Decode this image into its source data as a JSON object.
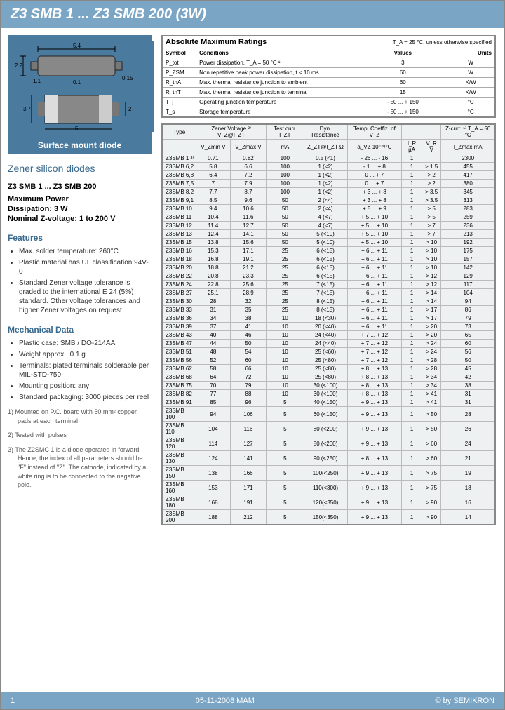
{
  "header": "Z3 SMB 1 ... Z3 SMB 200 (3W)",
  "diagram_caption": "Surface mount diode",
  "subtitle": "Zener silicon diodes",
  "part_range": "Z3 SMB 1 ... Z3 SMB 200",
  "spec1": "Maximum Power",
  "spec2": "Dissipation: 3 W",
  "spec3": "Nominal Z-voltage: 1 to 200 V",
  "features_hdr": "Features",
  "features": [
    "Max. solder temperature: 260°C",
    "Plastic material has UL classification 94V-0",
    "Standard Zener voltage tolerance is graded to the international E 24 (5%) standard. Other voltage tolerances and higher Zener voltages on request."
  ],
  "mech_hdr": "Mechanical Data",
  "mech": [
    "Plastic case: SMB / DO-214AA",
    "Weight approx.: 0.1 g",
    "Terminals: plated terminals solderable per MIL-STD-750",
    "Mounting position: any",
    "Standard packaging: 3000 pieces per reel"
  ],
  "notes": [
    "1) Mounted on P.C. board with 50 mm² copper pads at each terminal",
    "2) Tested with pulses",
    "3) The Z2SMC 1 is a diode operated in forward. Hence, the index of all parameters should be \"F\" instead of \"Z\". The cathode, indicated by a white ring is to be connected to the negative pole."
  ],
  "abs": {
    "title": "Absolute Maximum Ratings",
    "cond": "T_A = 25 °C, unless otherwise specified",
    "hdrs": [
      "Symbol",
      "Conditions",
      "Values",
      "Units"
    ],
    "rows": [
      [
        "P_tot",
        "Power dissipation, T_A = 50 °C ¹⁾",
        "3",
        "W"
      ],
      [
        "P_ZSM",
        "Non repetitive peak power dissipation, t < 10 ms",
        "60",
        "W"
      ],
      [
        "R_thA",
        "Max. thermal resistance junction to ambient",
        "60",
        "K/W"
      ],
      [
        "R_thT",
        "Max. thermal resistance junction to terminal",
        "15",
        "K/W"
      ],
      [
        "T_j",
        "Operating junction temperature",
        "- 50 ... + 150",
        "°C"
      ],
      [
        "T_s",
        "Storage temperature",
        "- 50 ... + 150",
        "°C"
      ]
    ]
  },
  "spec": {
    "hdr1": [
      "Type",
      "Zener Voltage ²⁾ V_Z@I_ZT",
      "Test curr. I_ZT",
      "Dyn. Resistance",
      "Temp. Coeffiz. of V_Z",
      "",
      "",
      "Z-curr. ¹⁾ T_A = 50 °C"
    ],
    "hdr2": [
      "",
      "V_Zmin V",
      "V_Zmax V",
      "mA",
      "Z_ZT@I_ZT Ω",
      "a_VZ 10⁻⁴/°C",
      "I_R µA",
      "V_R V",
      "I_Zmax mA"
    ],
    "rows": [
      [
        "Z3SMB 1 ³⁾",
        "0.71",
        "0.82",
        "100",
        "0.5 (<1)",
        "- 26 ... - 16",
        "1",
        "",
        "2300"
      ],
      [
        "Z3SMB 6,2",
        "5.8",
        "6.6",
        "100",
        "1 (<2)",
        "- 1 ... + 8",
        "1",
        "> 1.5",
        "455"
      ],
      [
        "Z3SMB 6,8",
        "6.4",
        "7.2",
        "100",
        "1 (<2)",
        "0 ... + 7",
        "1",
        "> 2",
        "417"
      ],
      [
        "Z3SMB 7,5",
        "7",
        "7.9",
        "100",
        "1 (<2)",
        "0 ... + 7",
        "1",
        "> 2",
        "380"
      ],
      [
        "Z3SMB 8,2",
        "7.7",
        "8.7",
        "100",
        "1 (<2)",
        "+ 3 ... + 8",
        "1",
        "> 3.5",
        "345"
      ],
      [
        "Z3SMB 9,1",
        "8.5",
        "9.6",
        "50",
        "2 (<4)",
        "+ 3 ... + 8",
        "1",
        "> 3.5",
        "313"
      ],
      [
        "Z3SMB 10",
        "9.4",
        "10.6",
        "50",
        "2 (<4)",
        "+ 5 ... + 9",
        "1",
        "> 5",
        "283"
      ],
      [
        "Z3SMB 11",
        "10.4",
        "11.6",
        "50",
        "4 (<7)",
        "+ 5 ... + 10",
        "1",
        "> 5",
        "259"
      ],
      [
        "Z3SMB 12",
        "11.4",
        "12.7",
        "50",
        "4 (<7)",
        "+ 5 ... + 10",
        "1",
        "> 7",
        "236"
      ],
      [
        "Z3SMB 13",
        "12.4",
        "14.1",
        "50",
        "5 (<10)",
        "+ 5 ... + 10",
        "1",
        "> 7",
        "213"
      ],
      [
        "Z3SMB 15",
        "13.8",
        "15.6",
        "50",
        "5 (<10)",
        "+ 5 ... + 10",
        "1",
        "> 10",
        "192"
      ],
      [
        "Z3SMB 16",
        "15.3",
        "17.1",
        "25",
        "6 (<15)",
        "+ 6 ... + 11",
        "1",
        "> 10",
        "175"
      ],
      [
        "Z3SMB 18",
        "16.8",
        "19.1",
        "25",
        "6 (<15)",
        "+ 6 ... + 11",
        "1",
        "> 10",
        "157"
      ],
      [
        "Z3SMB 20",
        "18.8",
        "21.2",
        "25",
        "6 (<15)",
        "+ 6 ... + 11",
        "1",
        "> 10",
        "142"
      ],
      [
        "Z3SMB 22",
        "20.8",
        "23.3",
        "25",
        "6 (<15)",
        "+ 6 ... + 11",
        "1",
        "> 12",
        "129"
      ],
      [
        "Z3SMB 24",
        "22.8",
        "25.6",
        "25",
        "7 (<15)",
        "+ 6 ... + 11",
        "1",
        "> 12",
        "117"
      ],
      [
        "Z3SMB 27",
        "25.1",
        "28.9",
        "25",
        "7 (<15)",
        "+ 6 ... + 11",
        "1",
        "> 14",
        "104"
      ],
      [
        "Z3SMB 30",
        "28",
        "32",
        "25",
        "8 (<15)",
        "+ 6 ... + 11",
        "1",
        "> 14",
        "94"
      ],
      [
        "Z3SMB 33",
        "31",
        "35",
        "25",
        "8 (<15)",
        "+ 6 ... + 11",
        "1",
        "> 17",
        "86"
      ],
      [
        "Z3SMB 36",
        "34",
        "38",
        "10",
        "18 (<30)",
        "+ 6 ... + 11",
        "1",
        "> 17",
        "79"
      ],
      [
        "Z3SMB 39",
        "37",
        "41",
        "10",
        "20 (<40)",
        "+ 6 ... + 11",
        "1",
        "> 20",
        "73"
      ],
      [
        "Z3SMB 43",
        "40",
        "46",
        "10",
        "24 (<40)",
        "+ 7 ... + 12",
        "1",
        "> 20",
        "65"
      ],
      [
        "Z3SMB 47",
        "44",
        "50",
        "10",
        "24 (<40)",
        "+ 7 ... + 12",
        "1",
        "> 24",
        "60"
      ],
      [
        "Z3SMB 51",
        "48",
        "54",
        "10",
        "25 (<60)",
        "+ 7 ... + 12",
        "1",
        "> 24",
        "56"
      ],
      [
        "Z3SMB 56",
        "52",
        "60",
        "10",
        "25 (<80)",
        "+ 7 ... + 12",
        "1",
        "> 28",
        "50"
      ],
      [
        "Z3SMB 62",
        "58",
        "66",
        "10",
        "25 (<80)",
        "+ 8 ... + 13",
        "1",
        "> 28",
        "45"
      ],
      [
        "Z3SMB 68",
        "64",
        "72",
        "10",
        "25 (<80)",
        "+ 8 ... + 13",
        "1",
        "> 34",
        "42"
      ],
      [
        "Z3SMB 75",
        "70",
        "79",
        "10",
        "30 (<100)",
        "+ 8 ... + 13",
        "1",
        "> 34",
        "38"
      ],
      [
        "Z3SMB 82",
        "77",
        "88",
        "10",
        "30 (<100)",
        "+ 8 ... + 13",
        "1",
        "> 41",
        "31"
      ],
      [
        "Z3SMB 91",
        "85",
        "96",
        "5",
        "40 (<150)",
        "+ 9 ... + 13",
        "1",
        "> 41",
        "31"
      ],
      [
        "Z3SMB 100",
        "94",
        "106",
        "5",
        "60 (<150)",
        "+ 9 ... + 13",
        "1",
        "> 50",
        "28"
      ],
      [
        "Z3SMB 110",
        "104",
        "116",
        "5",
        "80 (<200)",
        "+ 9 ... + 13",
        "1",
        "> 50",
        "26"
      ],
      [
        "Z3SMB 120",
        "114",
        "127",
        "5",
        "80 (<200)",
        "+ 9 ... + 13",
        "1",
        "> 60",
        "24"
      ],
      [
        "Z3SMB 130",
        "124",
        "141",
        "5",
        "90 (<250)",
        "+ 8 ... + 13",
        "1",
        "> 60",
        "21"
      ],
      [
        "Z3SMB 150",
        "138",
        "166",
        "5",
        "100(<250)",
        "+ 9 ... + 13",
        "1",
        "> 75",
        "19"
      ],
      [
        "Z3SMB 160",
        "153",
        "171",
        "5",
        "110(<300)",
        "+ 9 ... + 13",
        "1",
        "> 75",
        "18"
      ],
      [
        "Z3SMB 180",
        "168",
        "191",
        "5",
        "120(<350)",
        "+ 9 ... + 13",
        "1",
        "> 90",
        "16"
      ],
      [
        "Z3SMB 200",
        "188",
        "212",
        "5",
        "150(<350)",
        "+ 9 ... + 13",
        "1",
        "> 90",
        "14"
      ]
    ]
  },
  "footer": {
    "page": "1",
    "date": "05-11-2008  MAM",
    "copy": "© by SEMIKRON"
  }
}
